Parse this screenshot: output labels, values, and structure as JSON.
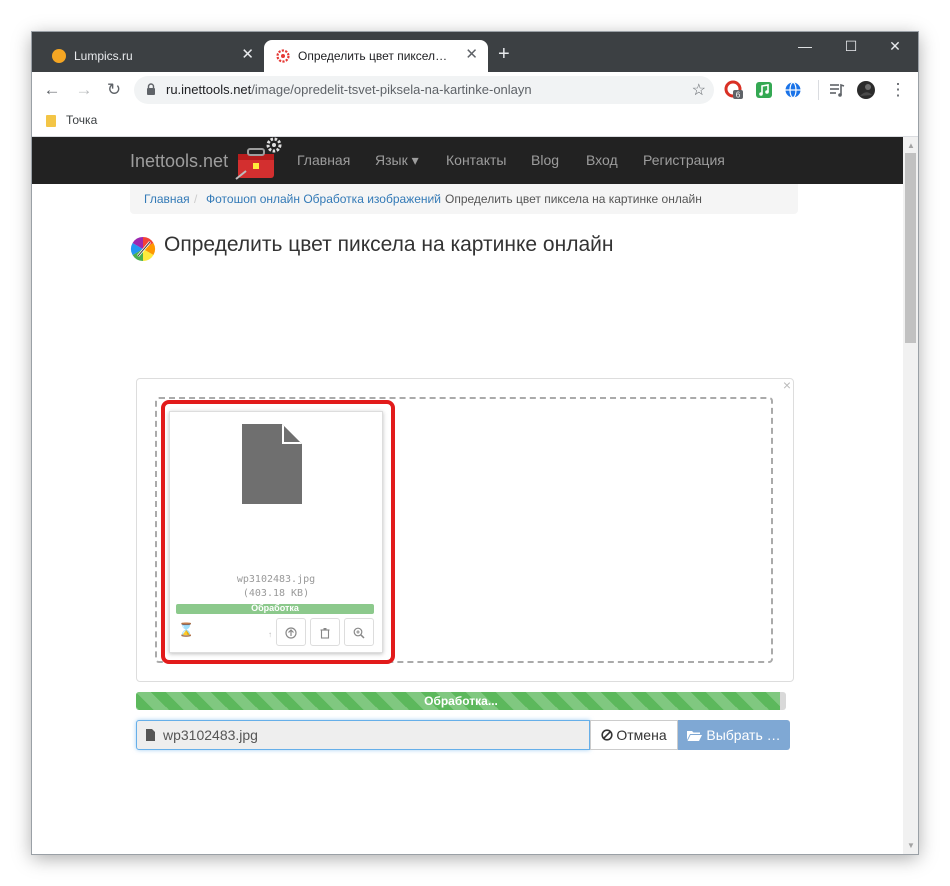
{
  "browser": {
    "tabs": [
      {
        "title": "Lumpics.ru",
        "close": "✕",
        "favicon": "lumpics-favicon",
        "color": "#f5a623"
      },
      {
        "title": "Определить цвет пиксела на ка…",
        "close": "✕",
        "favicon": "gear-favicon",
        "color": "#e53935"
      }
    ],
    "new_tab": "+",
    "controls": {
      "minimize": "—",
      "maximize": "☐",
      "close": "✕"
    },
    "url_host": "ru.inettools.net",
    "url_path": "/image/opredelit-tsvet-piksela-na-kartinke-onlayn",
    "extension_badge": "6",
    "bookmark": "Точка"
  },
  "site": {
    "brand": "Inettools.net",
    "nav": [
      "Главная",
      "Язык ▾",
      "Контакты",
      "Blog",
      "Вход",
      "Регистрация"
    ],
    "breadcrumbs": [
      "Главная",
      "Фотошоп онлайн Обработка изображений",
      "Определить цвет пиксела на картинке онлайн"
    ],
    "breadcrumb_sep": "/",
    "title": "Определить цвет пиксела на картинке онлайн"
  },
  "uploader": {
    "close": "×",
    "file_name": "wp3102483.jpg",
    "file_size": "(403.18 KB)",
    "thumb_progress_label": "Обработка",
    "thumb_progress": 1.0,
    "thumb_status": "↑",
    "progress_label": "Обработка...",
    "progress": 0.99,
    "caption": "wp3102483.jpg",
    "cancel_label": "Отмена",
    "browse_label": "Выбрать …"
  },
  "colors": {
    "highlight": "#e21b1b",
    "progress": "#5cb85c",
    "navbar": "#222222",
    "link": "#337ab7"
  }
}
